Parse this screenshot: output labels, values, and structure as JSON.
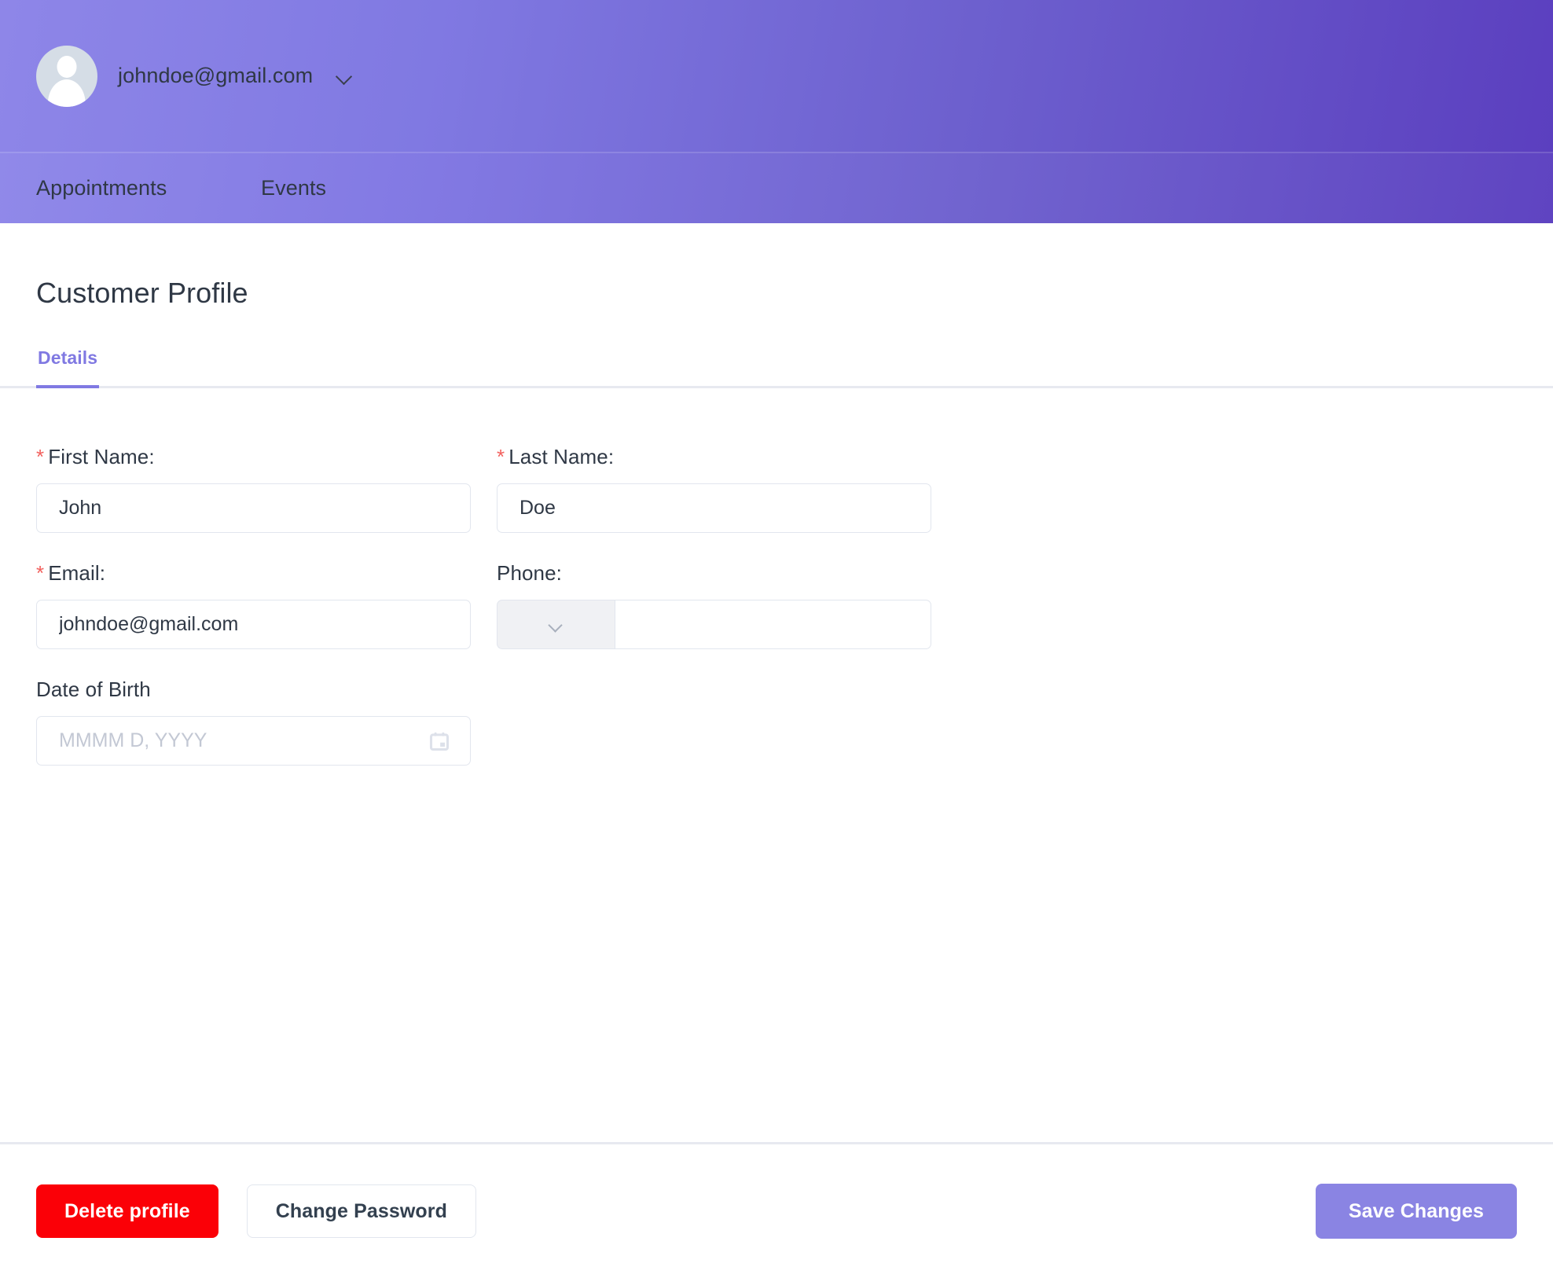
{
  "header": {
    "account_email": "johndoe@gmail.com",
    "avatar_icon": "user-avatar-icon",
    "dropdown_icon": "chevron-down-icon"
  },
  "nav": {
    "items": [
      {
        "label": "Appointments"
      },
      {
        "label": "Events"
      }
    ]
  },
  "page": {
    "title": "Customer Profile"
  },
  "tabs": [
    {
      "label": "Details",
      "active": true
    }
  ],
  "form": {
    "first_name": {
      "label": "First Name:",
      "required": true,
      "required_marker": "*",
      "value": "John",
      "placeholder": ""
    },
    "last_name": {
      "label": "Last Name:",
      "required": true,
      "required_marker": "*",
      "value": "Doe",
      "placeholder": ""
    },
    "email": {
      "label": "Email:",
      "required": true,
      "required_marker": "*",
      "value": "johndoe@gmail.com",
      "placeholder": ""
    },
    "phone": {
      "label": "Phone:",
      "required": false,
      "value": "",
      "placeholder": "",
      "country_code_value": "",
      "country_code_icon": "chevron-down-icon"
    },
    "date_of_birth": {
      "label": "Date of Birth",
      "required": false,
      "value": "",
      "placeholder": "MMMM D, YYYY",
      "calendar_icon": "calendar-icon"
    }
  },
  "footer": {
    "delete_label": "Delete profile",
    "change_password_label": "Change Password",
    "save_label": "Save Changes"
  },
  "colors": {
    "header_gradient_start": "#8e86e8",
    "header_gradient_end": "#5b3fbf",
    "accent_purple": "#8079e2",
    "save_button": "#8a84e3",
    "delete_button": "#fb0007",
    "required_asterisk": "#f2605d",
    "text_dark": "#2f3845",
    "border_light": "#e2e6ee"
  }
}
